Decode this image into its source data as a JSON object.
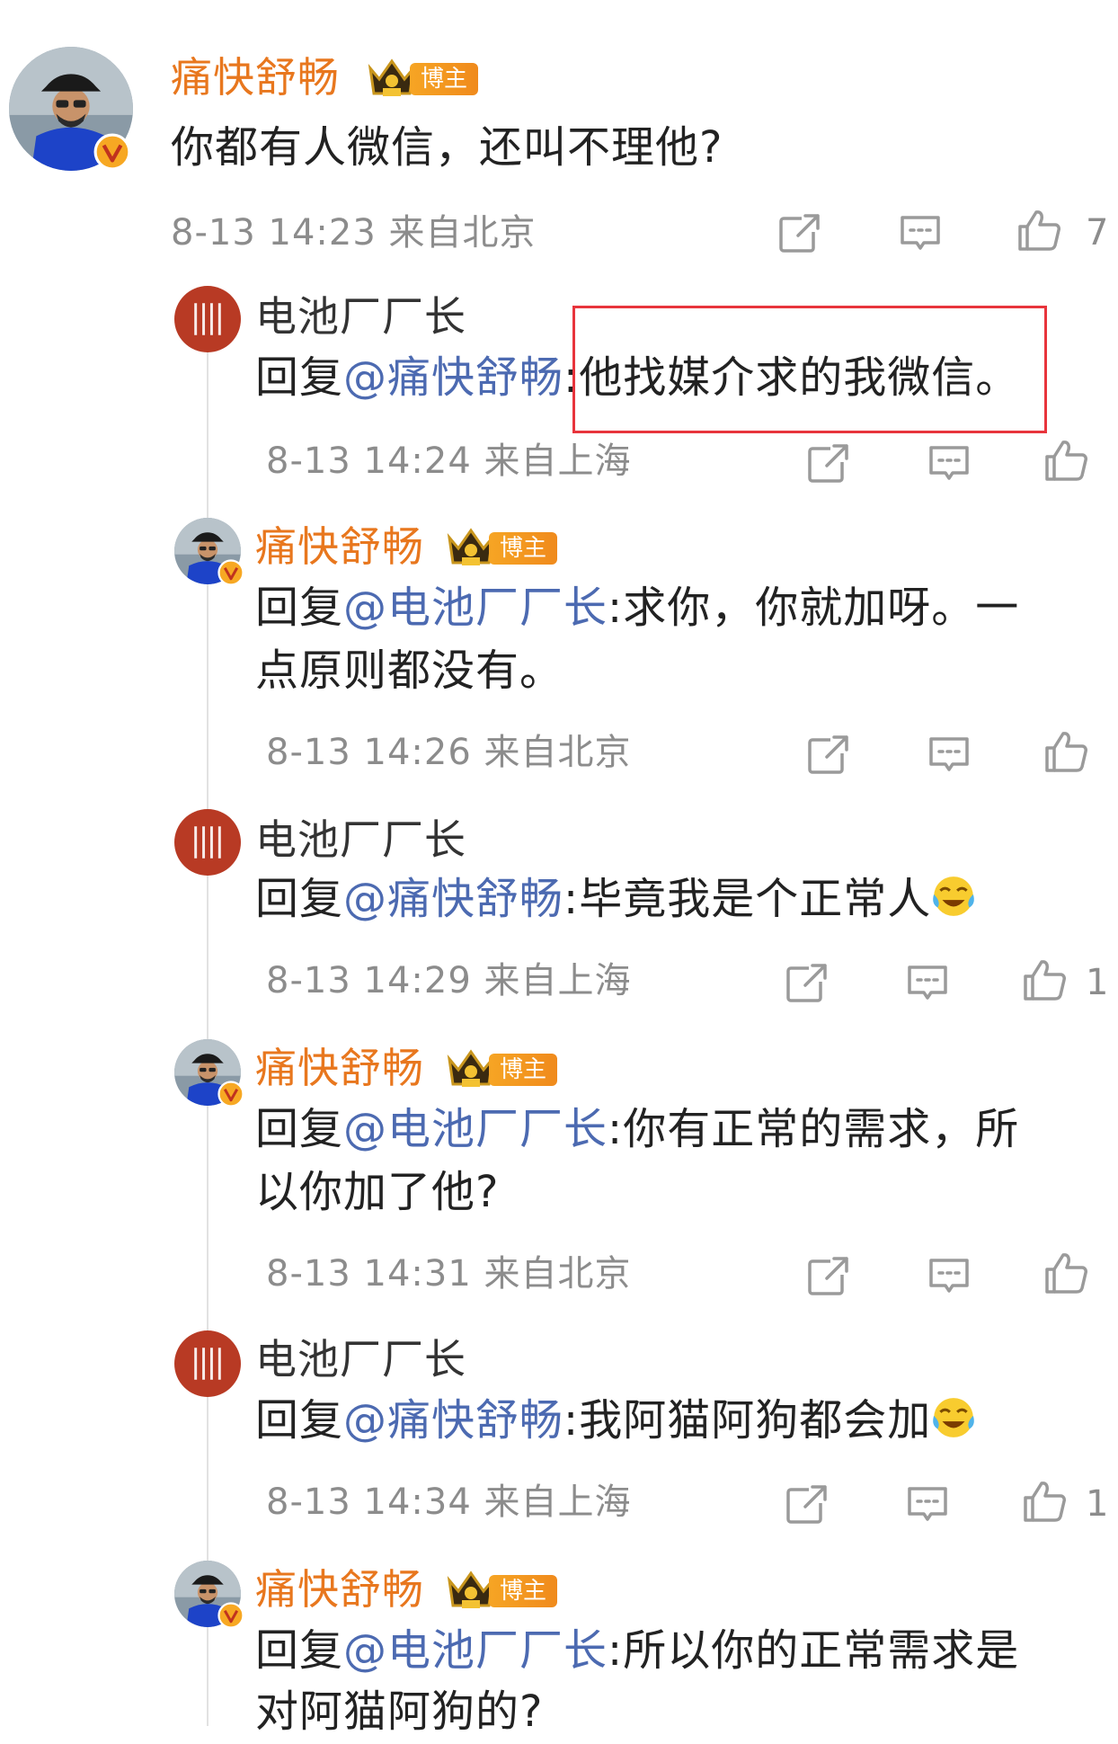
{
  "top_comment": {
    "author": "痛快舒畅",
    "badge": "博主",
    "text": "你都有人微信，还叫不理他?",
    "meta": "8-13 14:23 来自北京",
    "likes": "7"
  },
  "replies": [
    {
      "author": "电池厂厂长",
      "prefix": "回复",
      "mention": "@痛快舒畅",
      "sep": ":",
      "text": "他找媒介求的我微信。",
      "meta": "8-13 14:24 来自上海",
      "likes": ""
    },
    {
      "author": "痛快舒畅",
      "badge": "博主",
      "prefix": "回复",
      "mention": "@电池厂厂长",
      "sep": ":",
      "text": "求你，你就加呀。一",
      "text2": "点原则都没有。",
      "meta": "8-13 14:26 来自北京",
      "likes": ""
    },
    {
      "author": "电池厂厂长",
      "prefix": "回复",
      "mention": "@痛快舒畅",
      "sep": ":",
      "text": "毕竟我是个正常人",
      "meta": "8-13 14:29 来自上海",
      "likes": "1"
    },
    {
      "author": "痛快舒畅",
      "badge": "博主",
      "prefix": "回复",
      "mention": "@电池厂厂长",
      "sep": ":",
      "text": "你有正常的需求，所",
      "text2": "以你加了他?",
      "meta": "8-13 14:31 来自北京",
      "likes": ""
    },
    {
      "author": "电池厂厂长",
      "prefix": "回复",
      "mention": "@痛快舒畅",
      "sep": ":",
      "text": "我阿猫阿狗都会加",
      "meta": "8-13 14:34 来自上海",
      "likes": "1"
    },
    {
      "author": "痛快舒畅",
      "badge": "博主",
      "prefix": "回复",
      "mention": "@电池厂厂长",
      "sep": ":",
      "text": "所以你的正常需求是",
      "text2": "对阿猫阿狗的?",
      "meta": "",
      "likes": ""
    }
  ],
  "icons": [
    "share-icon",
    "comment-icon",
    "like-icon",
    "verified-badge-icon",
    "crown-icon",
    "laughing-crying-emoji-icon"
  ],
  "colors": {
    "vip_name": "#e8771e",
    "mention": "#4c6ab1",
    "meta": "#8c8c8c",
    "highlight_box": "#e8343c",
    "badge": "#f08a1c"
  }
}
